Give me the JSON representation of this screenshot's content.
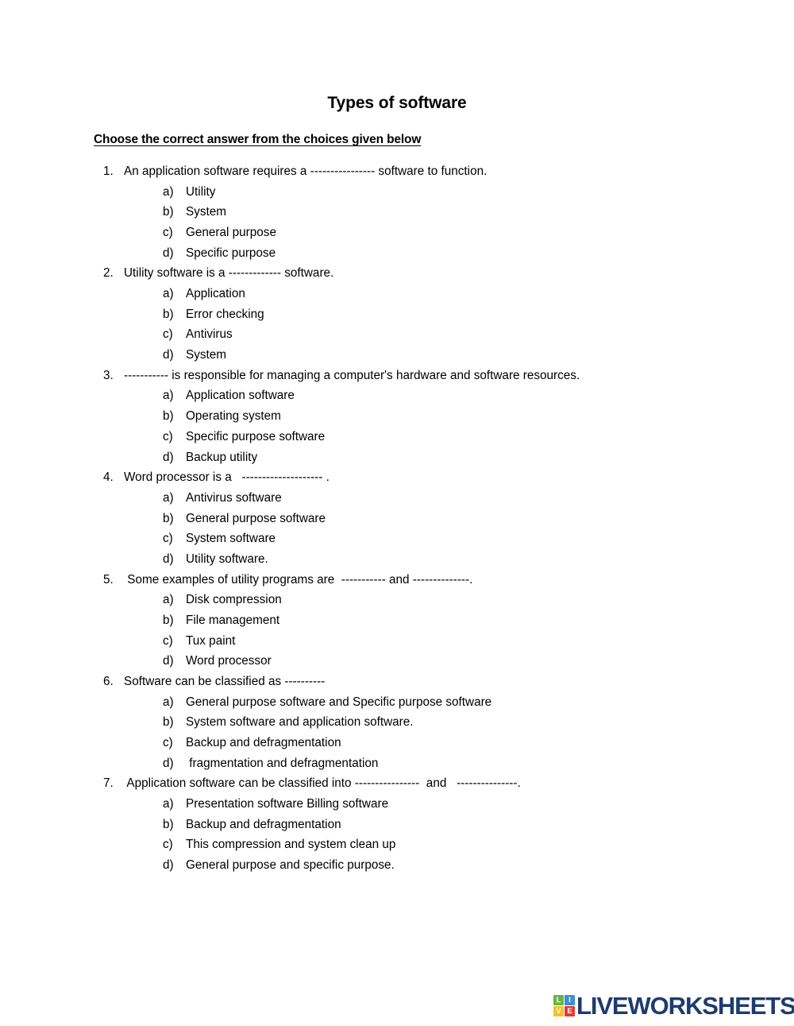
{
  "document": {
    "title": "Types of software",
    "instruction": "Choose the correct answer from the choices given below"
  },
  "questions": [
    {
      "number": "1.",
      "text": "An application software requires a ---------------- software to function.",
      "options": [
        {
          "letter": "a)",
          "text": "Utility"
        },
        {
          "letter": "b)",
          "text": "System"
        },
        {
          "letter": "c)",
          "text": "General purpose"
        },
        {
          "letter": "d)",
          "text": "Specific purpose"
        }
      ]
    },
    {
      "number": "2.",
      "text": "Utility software is a ------------- software.",
      "options": [
        {
          "letter": "a)",
          "text": "Application"
        },
        {
          "letter": "b)",
          "text": "Error checking"
        },
        {
          "letter": "c)",
          "text": "Antivirus"
        },
        {
          "letter": "d)",
          "text": "System"
        }
      ]
    },
    {
      "number": "3.",
      "text": "----------- is responsible for managing a computer's hardware and software resources.",
      "options": [
        {
          "letter": "a)",
          "text": "Application software"
        },
        {
          "letter": "b)",
          "text": "Operating system"
        },
        {
          "letter": "c)",
          "text": "Specific purpose software"
        },
        {
          "letter": "d)",
          "text": "Backup utility"
        }
      ]
    },
    {
      "number": "4.",
      "text": "Word processor is a   -------------------- .",
      "options": [
        {
          "letter": "a)",
          "text": "Antivirus software"
        },
        {
          "letter": "b)",
          "text": "General purpose software"
        },
        {
          "letter": "c)",
          "text": "System software"
        },
        {
          "letter": "d)",
          "text": "Utility software."
        }
      ]
    },
    {
      "number": "5.",
      "text": " Some examples of utility programs are  ----------- and --------------.",
      "options": [
        {
          "letter": "a)",
          "text": "Disk compression"
        },
        {
          "letter": "b)",
          "text": "File management"
        },
        {
          "letter": "c)",
          "text": "Tux paint"
        },
        {
          "letter": "d)",
          "text": "Word processor"
        }
      ]
    },
    {
      "number": "6.",
      "text": "Software can be classified as ----------",
      "options": [
        {
          "letter": "a)",
          "text": "General purpose software and Specific purpose software"
        },
        {
          "letter": "b)",
          "text": "System software and application software."
        },
        {
          "letter": "c)",
          "text": "Backup and defragmentation"
        },
        {
          "letter": "d)",
          "text": " fragmentation and defragmentation"
        }
      ]
    },
    {
      "number": "7.",
      "text": " Application software can be classified into ----------------  and   ---------------.",
      "options": [
        {
          "letter": "a)",
          "text": "Presentation software Billing software"
        },
        {
          "letter": "b)",
          "text": "Backup and defragmentation"
        },
        {
          "letter": "c)",
          "text": "This compression and system clean up"
        },
        {
          "letter": "d)",
          "text": "General purpose and specific purpose."
        }
      ]
    }
  ],
  "logo": {
    "wordmark": "LIVEWORKSHEETS",
    "wordmark_color": "#1d3c6e",
    "tiles": [
      {
        "letter": "L",
        "color": "#67b54a"
      },
      {
        "letter": "I",
        "color": "#3b8fd4"
      },
      {
        "letter": "V",
        "color": "#f2c230"
      },
      {
        "letter": "E",
        "color": "#e23b35"
      }
    ]
  }
}
